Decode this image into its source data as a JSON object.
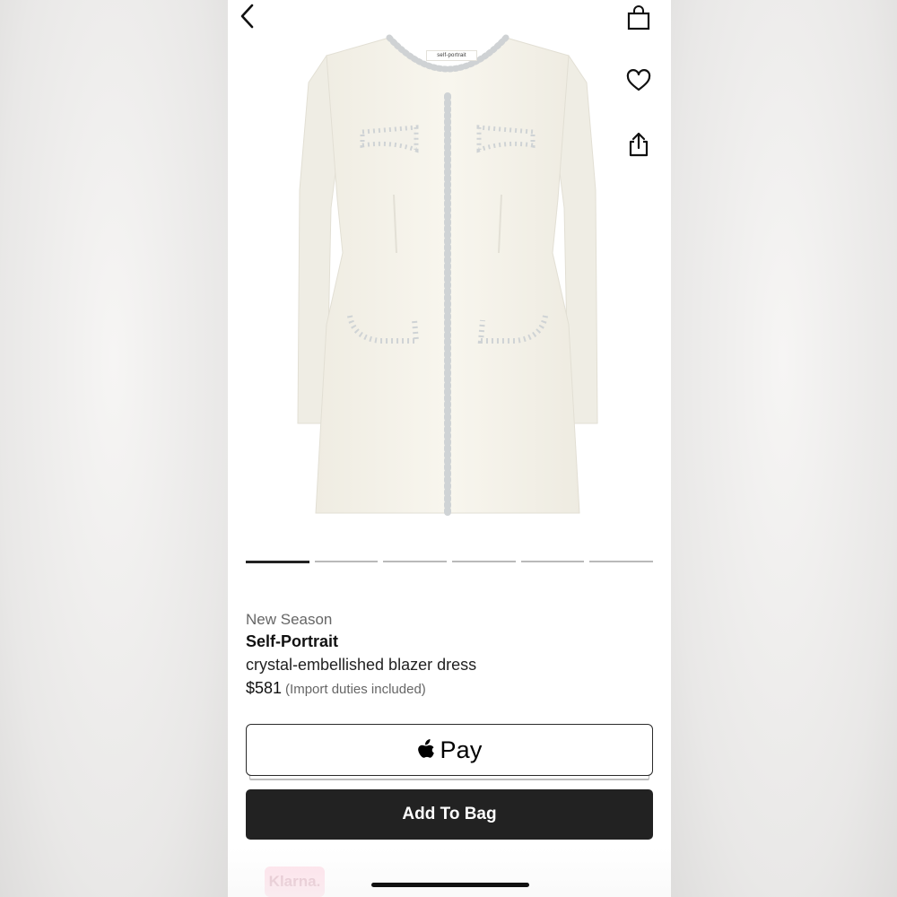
{
  "header": {
    "back_icon": "chevron-left-icon",
    "bag_icon": "shopping-bag-icon",
    "wishlist_icon": "heart-icon",
    "share_icon": "share-icon"
  },
  "product_image": {
    "label_text": "self-portrait"
  },
  "carousel": {
    "count": 6,
    "active_index": 0
  },
  "product": {
    "season": "New Season",
    "brand": "Self-Portrait",
    "name": "crystal-embellished blazer dress",
    "price": "$581",
    "duties_note": "(Import duties included)"
  },
  "actions": {
    "apple_pay_label": "Pay",
    "apple_pay_icon": "apple-logo-icon",
    "add_to_bag_label": "Add To Bag"
  },
  "payment": {
    "klarna_label": "Klarna."
  },
  "colors": {
    "button_dark": "#222222",
    "klarna_pink": "#ffd7e3"
  }
}
